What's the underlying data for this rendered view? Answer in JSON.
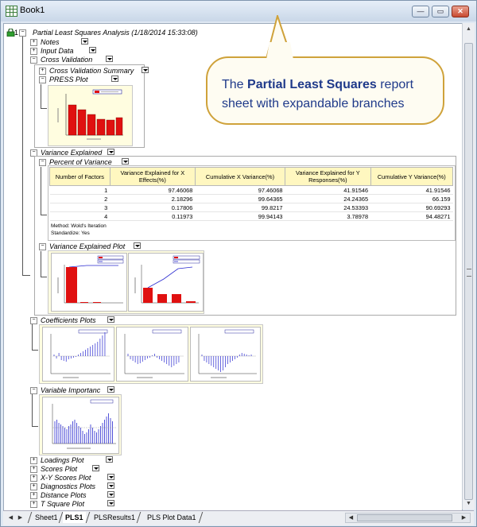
{
  "window": {
    "title": "Book1",
    "min_glyph": "—",
    "max_glyph": "▭",
    "close_glyph": "✕"
  },
  "tree": {
    "root_index": "1",
    "root_title": "Partial Least Squares Analysis (1/18/2014 15:33:08)",
    "notes": "Notes",
    "input_data": "Input Data",
    "cross_validation": "Cross Validation",
    "cv_summary": "Cross Validation Summary",
    "press_plot": "PRESS Plot",
    "variance_explained": "Variance Explained",
    "percent_of_variance": "Percent of Variance",
    "variance_explained_plot": "Variance Explained Plot",
    "coefficients_plots": "Coefficients Plots",
    "variable_importance": "Variable Importanc",
    "bottom_items": [
      "Loadings Plot",
      "Scores Plot",
      "X-Y Scores Plot",
      "Diagnostics Plots",
      "Distance Plots",
      "T Square Plot"
    ]
  },
  "pov_table": {
    "headers": [
      "Number of Factors",
      "Variance Explained for X Effects(%)",
      "Cumulative X Variance(%)",
      "Variance Explained for Y Responses(%)",
      "Cumulative Y Variance(%)"
    ],
    "rows": [
      [
        "1",
        "97.46068",
        "97.46068",
        "41.91546",
        "41.91546"
      ],
      [
        "2",
        "2.18296",
        "99.64365",
        "24.24365",
        "66.159"
      ],
      [
        "3",
        "0.17806",
        "99.8217",
        "24.53393",
        "90.69293"
      ],
      [
        "4",
        "0.11973",
        "99.94143",
        "3.78978",
        "94.48271"
      ]
    ],
    "method": "Method: Wold's Iteration",
    "standardize": "Standardize: Yes"
  },
  "callout": {
    "prefix": "The ",
    "bold": "Partial Least Squares",
    "suffix": " report sheet with expandable branches"
  },
  "sheets": [
    "Sheet1",
    "PLS1",
    "PLSResults1",
    "PLS Plot Data1"
  ],
  "active_sheet": "PLS1",
  "colors": {
    "accent_bar": "#e01010",
    "callout_border": "#cfa23a",
    "callout_text": "#1f3a8a",
    "thumb_bg": "#fffde0"
  }
}
